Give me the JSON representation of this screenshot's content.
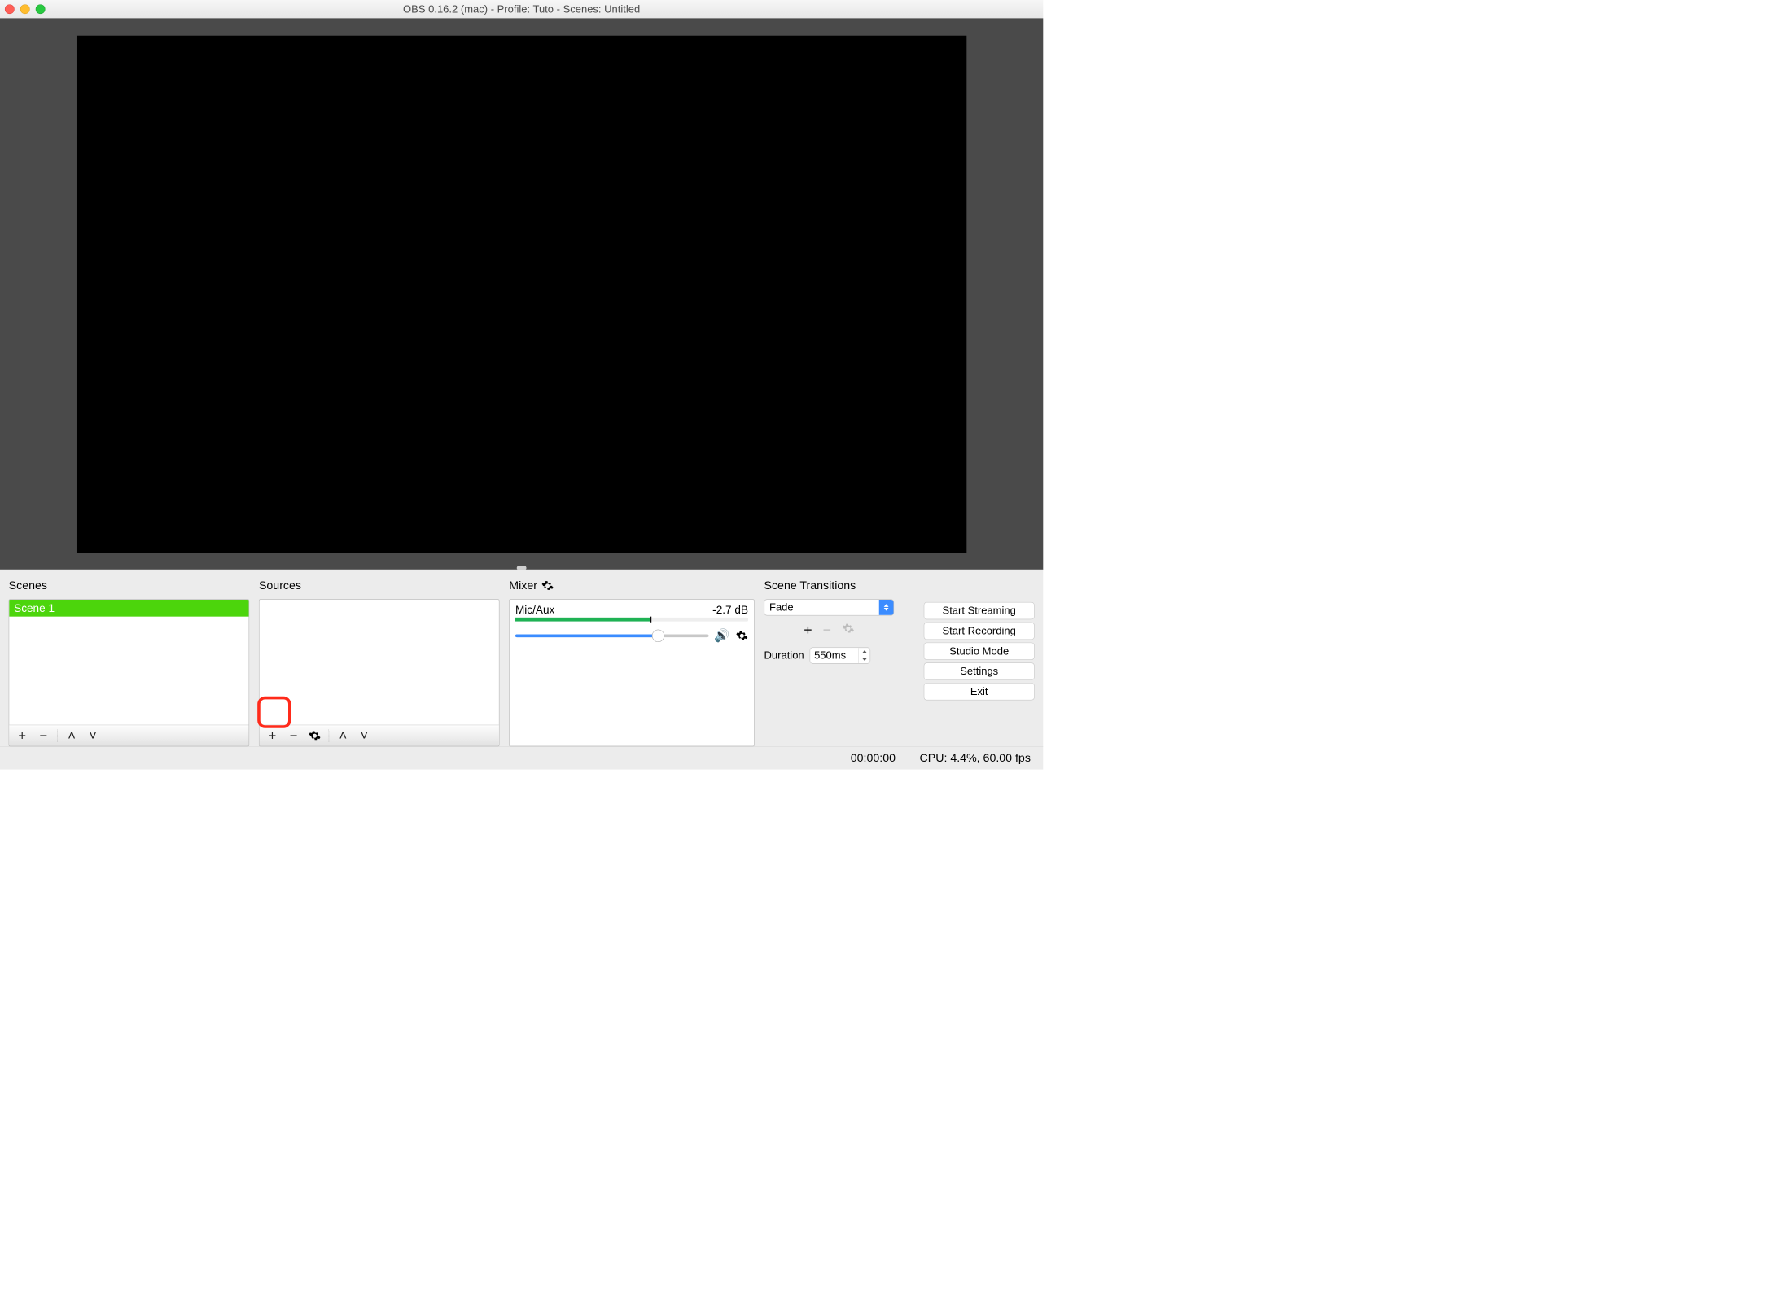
{
  "window": {
    "title": "OBS 0.16.2 (mac) - Profile: Tuto - Scenes: Untitled"
  },
  "panels": {
    "scenes": {
      "label": "Scenes",
      "items": [
        "Scene 1"
      ],
      "selected_index": 0
    },
    "sources": {
      "label": "Sources",
      "items": []
    },
    "mixer": {
      "label": "Mixer",
      "channel_name": "Mic/Aux",
      "db_readout": "-2.7 dB",
      "meter_pct": 58,
      "slider_pct": 74
    },
    "transitions": {
      "label": "Scene Transitions",
      "selected": "Fade",
      "duration_label": "Duration",
      "duration_value": "550ms"
    },
    "actions": {
      "start_streaming": "Start Streaming",
      "start_recording": "Start Recording",
      "studio_mode": "Studio Mode",
      "settings": "Settings",
      "exit": "Exit"
    }
  },
  "status": {
    "time": "00:00:00",
    "cpu": "CPU: 4.4%, 60.00 fps"
  },
  "icons": {
    "plus": "+",
    "minus": "−",
    "up": "˄",
    "down": "˅",
    "speaker": "🔊"
  }
}
